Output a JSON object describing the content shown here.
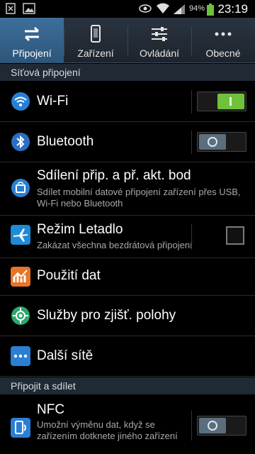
{
  "status_bar": {
    "battery_percent": "94%",
    "time": "23:19",
    "icons": [
      "sim-icon",
      "gallery-icon",
      "eye-icon",
      "wifi-icon",
      "signal-icon",
      "battery-icon"
    ]
  },
  "tabs": [
    {
      "label": "Připojení",
      "icon": "connections-icon",
      "active": true
    },
    {
      "label": "Zařízení",
      "icon": "device-icon",
      "active": false
    },
    {
      "label": "Ovládání",
      "icon": "controls-icon",
      "active": false
    },
    {
      "label": "Obecné",
      "icon": "more-icon",
      "active": false
    }
  ],
  "sections": {
    "network": "Síťová připojení",
    "connect_share": "Připojit a sdílet"
  },
  "rows": {
    "wifi": {
      "title": "Wi-Fi",
      "icon": "wifi-icon",
      "switch": "on"
    },
    "bluetooth": {
      "title": "Bluetooth",
      "icon": "bluetooth-icon",
      "switch": "off"
    },
    "tethering": {
      "title": "Sdílení přip. a př. akt. bod",
      "subtitle": "Sdílet mobilní datové připojení zařízení přes USB, Wi-Fi nebo Bluetooth",
      "icon": "hotspot-icon"
    },
    "airplane": {
      "title": "Režim Letadlo",
      "subtitle": "Zakázat všechna bezdrátová připojení",
      "icon": "airplane-icon",
      "checked": false
    },
    "data_usage": {
      "title": "Použití dat",
      "icon": "data-usage-icon"
    },
    "location": {
      "title": "Služby pro zjišť. polohy",
      "icon": "location-icon"
    },
    "more_networks": {
      "title": "Další sítě",
      "icon": "more-networks-icon"
    },
    "nfc": {
      "title": "NFC",
      "subtitle": "Umožní výměnu dat, když se zařízením dotknete jiného zařízení",
      "icon": "nfc-icon",
      "switch": "off"
    }
  },
  "colors": {
    "tab_active": "#3d6f9c",
    "section_bg": "#1f2a35",
    "switch_on": "#6ec23a",
    "switch_off": "#5a6e7e"
  }
}
